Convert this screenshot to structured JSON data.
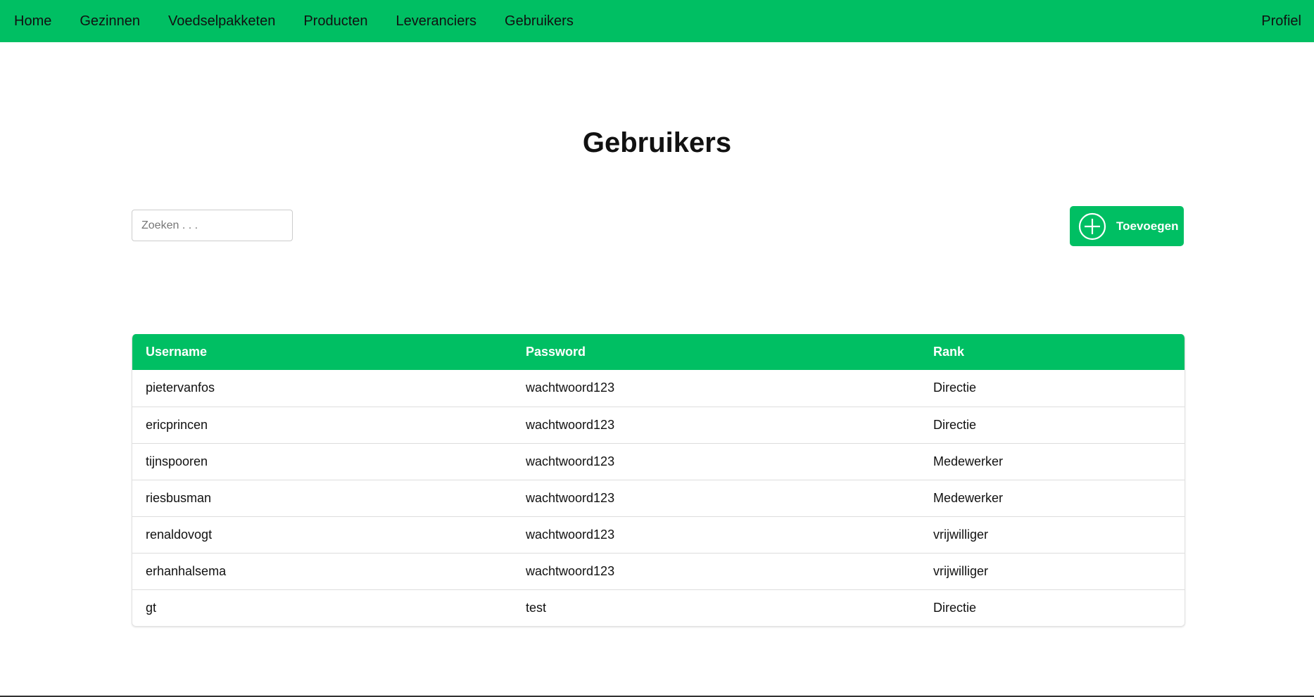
{
  "nav": {
    "items": [
      {
        "label": "Home",
        "name": "nav-item-home"
      },
      {
        "label": "Gezinnen",
        "name": "nav-item-gezinnen"
      },
      {
        "label": "Voedselpakketen",
        "name": "nav-item-voedselpakketen"
      },
      {
        "label": "Producten",
        "name": "nav-item-producten"
      },
      {
        "label": "Leveranciers",
        "name": "nav-item-leveranciers"
      },
      {
        "label": "Gebruikers",
        "name": "nav-item-gebruikers"
      }
    ],
    "profile": "Profiel"
  },
  "page": {
    "title": "Gebruikers"
  },
  "search": {
    "placeholder": "Zoeken . . .",
    "value": ""
  },
  "add_button": {
    "label": "Toevoegen",
    "icon": "plus-circle-icon"
  },
  "table": {
    "headers": [
      "Username",
      "Password",
      "Rank"
    ],
    "rows": [
      [
        "pietervanfos",
        "wachtwoord123",
        "Directie"
      ],
      [
        "ericprincen",
        "wachtwoord123",
        "Directie"
      ],
      [
        "tijnspooren",
        "wachtwoord123",
        "Medewerker"
      ],
      [
        "riesbusman",
        "wachtwoord123",
        "Medewerker"
      ],
      [
        "renaldovogt",
        "wachtwoord123",
        "vrijwilliger"
      ],
      [
        "erhanhalsema",
        "wachtwoord123",
        "vrijwilliger"
      ],
      [
        "gt",
        "test",
        "Directie"
      ]
    ]
  },
  "colors": {
    "accent": "#00bf63",
    "header_text": "#ffffff"
  }
}
